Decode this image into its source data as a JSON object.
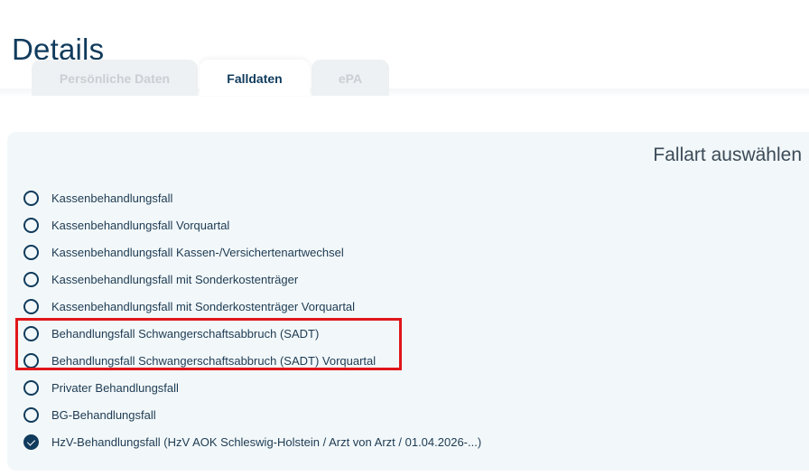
{
  "page": {
    "title": "Details"
  },
  "tabs": [
    {
      "label": "Persönliche Daten",
      "active": false
    },
    {
      "label": "Falldaten",
      "active": true
    },
    {
      "label": "ePA",
      "active": false
    }
  ],
  "panel": {
    "heading": "Fallart auswählen",
    "options": [
      {
        "label": "Kassenbehandlungsfall",
        "checked": false
      },
      {
        "label": "Kassenbehandlungsfall Vorquartal",
        "checked": false
      },
      {
        "label": "Kassenbehandlungsfall Kassen-/Versichertenartwechsel",
        "checked": false
      },
      {
        "label": "Kassenbehandlungsfall mit Sonderkostenträger",
        "checked": false
      },
      {
        "label": "Kassenbehandlungsfall mit Sonderkostenträger Vorquartal",
        "checked": false
      },
      {
        "label": "Behandlungsfall Schwangerschaftsabbruch (SADT)",
        "checked": false
      },
      {
        "label": "Behandlungsfall Schwangerschaftsabbruch (SADT) Vorquartal",
        "checked": false
      },
      {
        "label": "Privater Behandlungsfall",
        "checked": false
      },
      {
        "label": "BG-Behandlungsfall",
        "checked": false
      },
      {
        "label": "HzV-Behandlungsfall (HzV AOK Schleswig-Holstein / Arzt von Arzt / 01.04.2026-...)",
        "checked": true
      }
    ]
  },
  "colors": {
    "accent": "#103b5c",
    "panel_background": "#f2f8fa",
    "highlight": "#e0161b"
  }
}
